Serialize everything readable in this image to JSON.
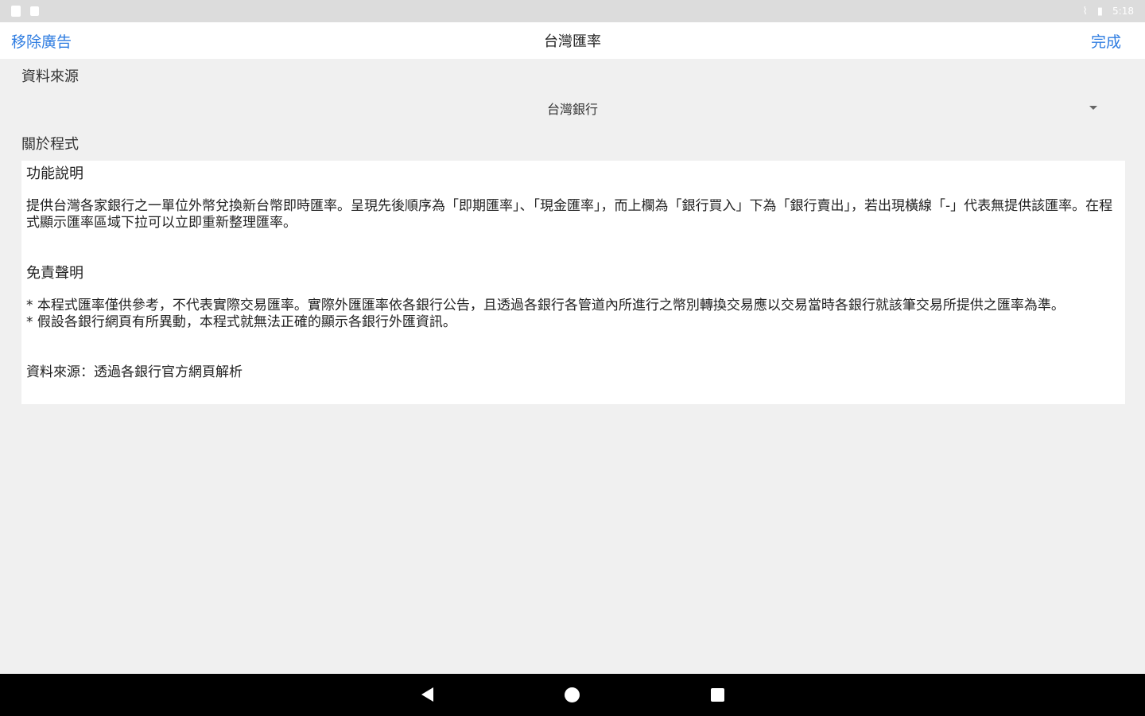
{
  "status_bar": {
    "time": "5:18",
    "left_icons": [
      "notification-icon",
      "notification-icon"
    ],
    "right_icons": [
      "wifi-off-icon",
      "battery-icon"
    ]
  },
  "header": {
    "left_label": "移除廣告",
    "title": "台灣匯率",
    "right_label": "完成",
    "accent_color": "#2f7de1"
  },
  "data_source": {
    "label": "資料來源",
    "selected": "台灣銀行"
  },
  "about": {
    "label": "關於程式",
    "feature_title": "功能說明",
    "feature_text": "提供台灣各家銀行之一單位外幣兌換新台幣即時匯率。呈現先後順序為「即期匯率」、「現金匯率」，而上欄為「銀行買入」下為「銀行賣出」，若出現橫線「-」代表無提供該匯率。在程式顯示匯率區域下拉可以立即重新整理匯率。",
    "disclaimer_title": "免責聲明",
    "disclaimer_1": "* 本程式匯率僅供參考，不代表實際交易匯率。實際外匯匯率依各銀行公告，且透過各銀行各管道內所進行之幣別轉換交易應以交易當時各銀行就該筆交易所提供之匯率為準。",
    "disclaimer_2": "* 假設各銀行網頁有所異動，本程式就無法正確的顯示各銀行外匯資訊。",
    "source_note": "資料來源：透過各銀行官方網頁解析"
  },
  "system_nav": {
    "buttons": [
      "back-icon",
      "home-icon",
      "recent-apps-icon"
    ]
  }
}
